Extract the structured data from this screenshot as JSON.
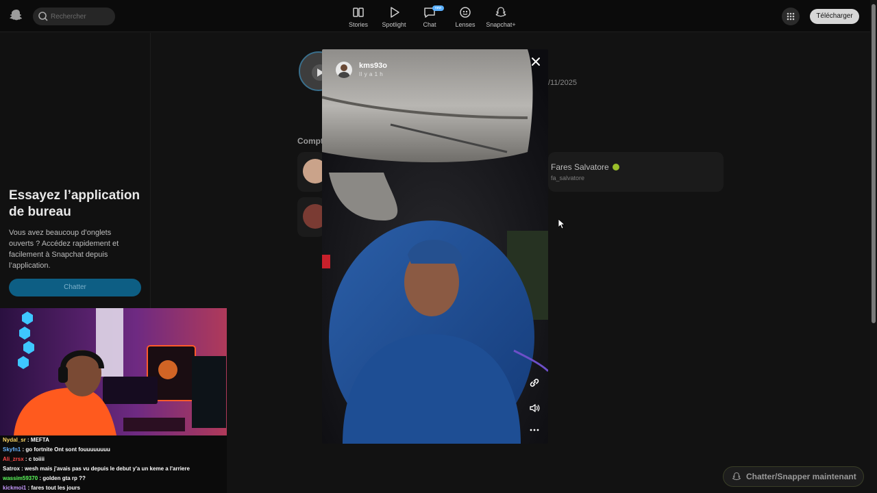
{
  "topbar": {
    "search_placeholder": "Rechercher",
    "nav": [
      {
        "label": "Stories",
        "icon": "stories-icon"
      },
      {
        "label": "Spotlight",
        "icon": "spotlight-icon"
      },
      {
        "label": "Chat",
        "icon": "chat-icon",
        "badge": "new"
      },
      {
        "label": "Lenses",
        "icon": "lenses-icon"
      },
      {
        "label": "Snapchat+",
        "icon": "snapchat-plus-icon"
      }
    ],
    "download_label": "Télécharger"
  },
  "promo": {
    "title": "Essayez l’application de bureau",
    "text": "Vous avez beaucoup d’onglets ouverts ? Accédez rapidement et facilement à Snapchat depuis l’application.",
    "button": "Chatter"
  },
  "background": {
    "date_fragment": "/11/2025",
    "section_fragment": "Compt",
    "suggested_name": "Fares Salvatore",
    "suggested_handle": "fa_salvatore"
  },
  "story": {
    "username": "kms93o",
    "time": "Il y a 1 h"
  },
  "stream_chat": [
    {
      "user": "Nydal_sr",
      "color": "#ffd866",
      "message": " : MEFTA"
    },
    {
      "user": "Skyfn1",
      "color": "#6ab4ff",
      "message": " : go fortnite Ont sont fouuuuuuuu"
    },
    {
      "user": "Ali_zrsx",
      "color": "#ff4a4a",
      "message": " : c toiiii"
    },
    {
      "user": "Satrox",
      "color": "#ffffff",
      "message": " : wesh mais j'avais pas vu depuis le debut y'a un keme a l'arriere"
    },
    {
      "user": "wassim59370",
      "color": "#5dff5d",
      "message": " : golden gta rp ??"
    },
    {
      "user": "kickmoi1",
      "color": "#c89aff",
      "message": " : fares tout les jours"
    }
  ],
  "chat_now_label": "Chatter/Snapper maintenant",
  "colors": {
    "accent_blue": "#0d5e84",
    "verified_badge": "#9bbf2a"
  }
}
